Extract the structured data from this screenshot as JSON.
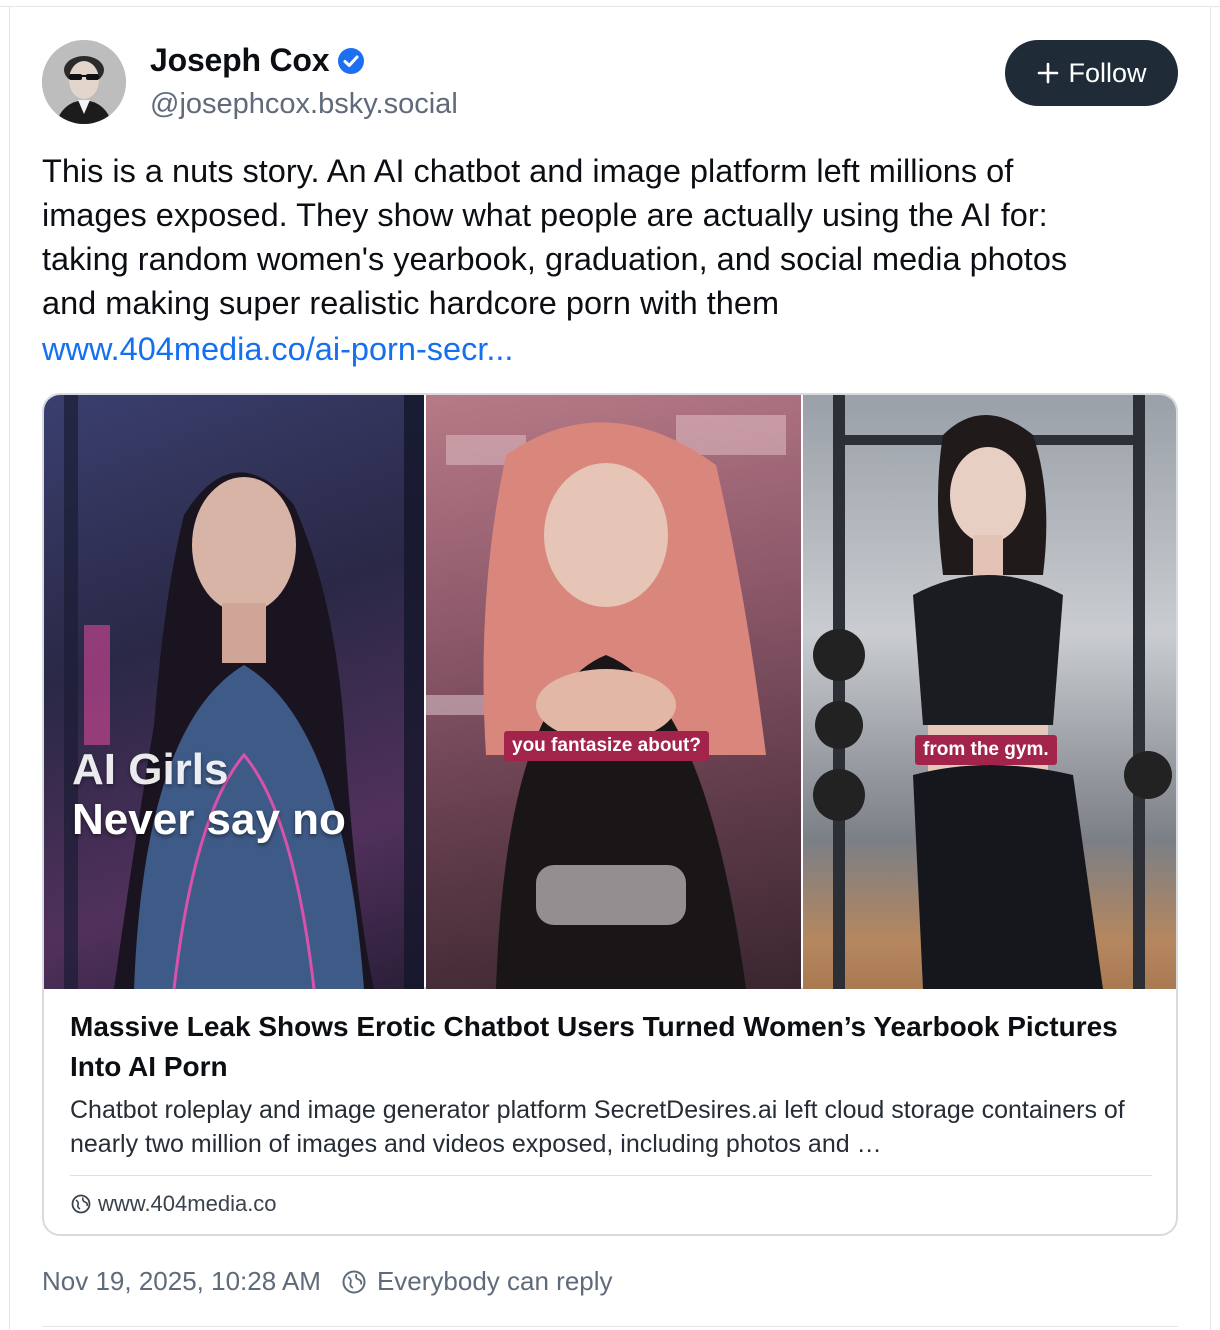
{
  "author": {
    "name": "Joseph Cox",
    "handle": "@josephcox.bsky.social",
    "verified": true
  },
  "follow_button": {
    "label": "Follow",
    "icon": "plus-icon"
  },
  "post": {
    "text": "This is a nuts story. An AI chatbot and image platform left millions of\nimages exposed. They show what people are actually using the AI for:\ntaking random women's yearbook, graduation, and social media photos\nand making super realistic hardcore porn with them",
    "link": "www.404media.co/ai-porn-secr..."
  },
  "embed": {
    "image_captions": {
      "panel1_line1": "AI Girls",
      "panel1_line2": "Never say no",
      "panel2": "you fantasize about?",
      "panel3": "from the gym."
    },
    "title": "Massive Leak Shows Erotic Chatbot Users Turned Women’s Yearbook Pictures Into AI Porn",
    "description": "Chatbot roleplay and image generator platform SecretDesires.ai left cloud storage containers of nearly two million of images and videos exposed, including photos and …",
    "domain": "www.404media.co"
  },
  "meta": {
    "timestamp": "Nov 19, 2025, 10:28 AM",
    "reply_setting": "Everybody can reply"
  },
  "colors": {
    "link": "#1570ef",
    "follow_bg": "#1f2b37",
    "verified": "#1d6ff2",
    "tag_bg": "#a3244a"
  }
}
